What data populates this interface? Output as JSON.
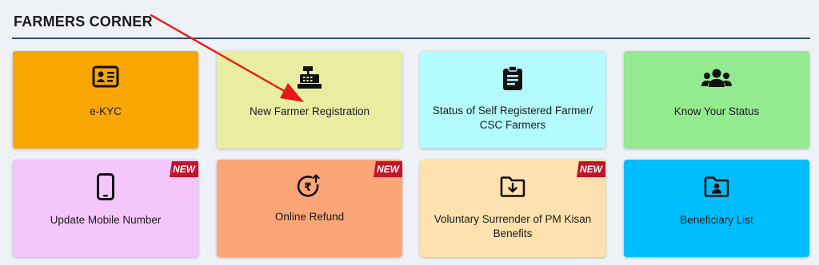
{
  "section": {
    "title": "FARMERS CORNER"
  },
  "colors": {
    "rule": "#27507a",
    "badge": "#c0152a",
    "arrow": "#e81818"
  },
  "cards": [
    {
      "label": "e-KYC",
      "icon": "id-card-icon",
      "bg": "#f9a602",
      "badge": ""
    },
    {
      "label": "New Farmer Registration",
      "icon": "cash-register-icon",
      "bg": "#e8eda1",
      "badge": ""
    },
    {
      "label": "Status of Self Registered Farmer/ CSC Farmers",
      "icon": "clipboard-icon",
      "bg": "#b3fbfd",
      "badge": ""
    },
    {
      "label": "Know Your Status",
      "icon": "users-group-icon",
      "bg": "#93ea8f",
      "badge": ""
    },
    {
      "label": "Update Mobile Number",
      "icon": "mobile-phone-icon",
      "bg": "#f5c6fb",
      "badge": "NEW"
    },
    {
      "label": "Online Refund",
      "icon": "rupee-refund-icon",
      "bg": "#fca577",
      "badge": "NEW"
    },
    {
      "label": "Voluntary Surrender of PM Kisan Benefits",
      "icon": "folder-download-icon",
      "bg": "#fde1ae",
      "badge": "NEW"
    },
    {
      "label": "Beneficiary List",
      "icon": "folder-user-icon",
      "bg": "#00bdfe",
      "badge": ""
    }
  ]
}
